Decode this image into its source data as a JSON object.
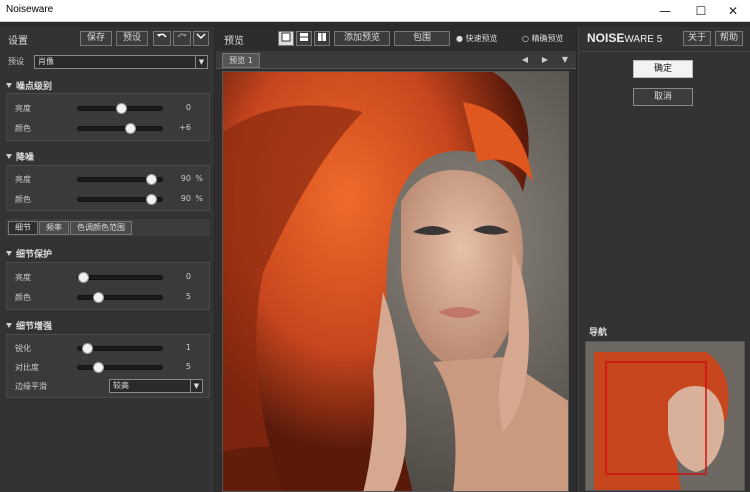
{
  "window": {
    "title": "Noiseware",
    "minimize": "—",
    "maximize": "☐",
    "close": "✕"
  },
  "left": {
    "header_title": "设置",
    "save_label": "保存",
    "preset_btn_label": "预设",
    "preset_label": "预设",
    "preset_value": "肖像",
    "noise_level": {
      "title": "噪点级别",
      "rows": [
        {
          "label": "亮度",
          "value": "0",
          "unit": "",
          "level": 0.5
        },
        {
          "label": "颜色",
          "value": "+6",
          "unit": "",
          "level": 0.62
        }
      ]
    },
    "denoise": {
      "title": "降噪",
      "rows": [
        {
          "label": "亮度",
          "value": "90",
          "unit": "%",
          "level": 0.9
        },
        {
          "label": "颜色",
          "value": "90",
          "unit": "%",
          "level": 0.9
        }
      ]
    },
    "tabs": [
      "细节",
      "频率",
      "色调颜色范围"
    ],
    "detail_protect": {
      "title": "细节保护",
      "rows": [
        {
          "label": "亮度",
          "value": "0",
          "unit": "",
          "level": 0.0
        },
        {
          "label": "颜色",
          "value": "5",
          "unit": "",
          "level": 0.2
        }
      ]
    },
    "detail_enhance": {
      "title": "细节增强",
      "rows": [
        {
          "label": "锐化",
          "value": "1",
          "unit": "",
          "level": 0.05
        },
        {
          "label": "对比度",
          "value": "5",
          "unit": "",
          "level": 0.2
        }
      ],
      "edge_label": "边缘平滑",
      "edge_value": "较高"
    }
  },
  "center": {
    "header_title": "预览",
    "add_preview_label": "添加预览",
    "wrap_label": "包围",
    "fast_preview_label": "快速预览",
    "accurate_preview_label": "精确预览",
    "tab_label": "预览 1"
  },
  "right": {
    "logo_bold": "NOISE",
    "logo_rest": "WARE 5",
    "about_label": "关于",
    "help_label": "帮助",
    "ok_label": "确定",
    "cancel_label": "取消",
    "nav_title": "导航"
  },
  "colors": {
    "hair": "#c8461e",
    "accent_red": "#d01010",
    "panel": "#333333"
  }
}
